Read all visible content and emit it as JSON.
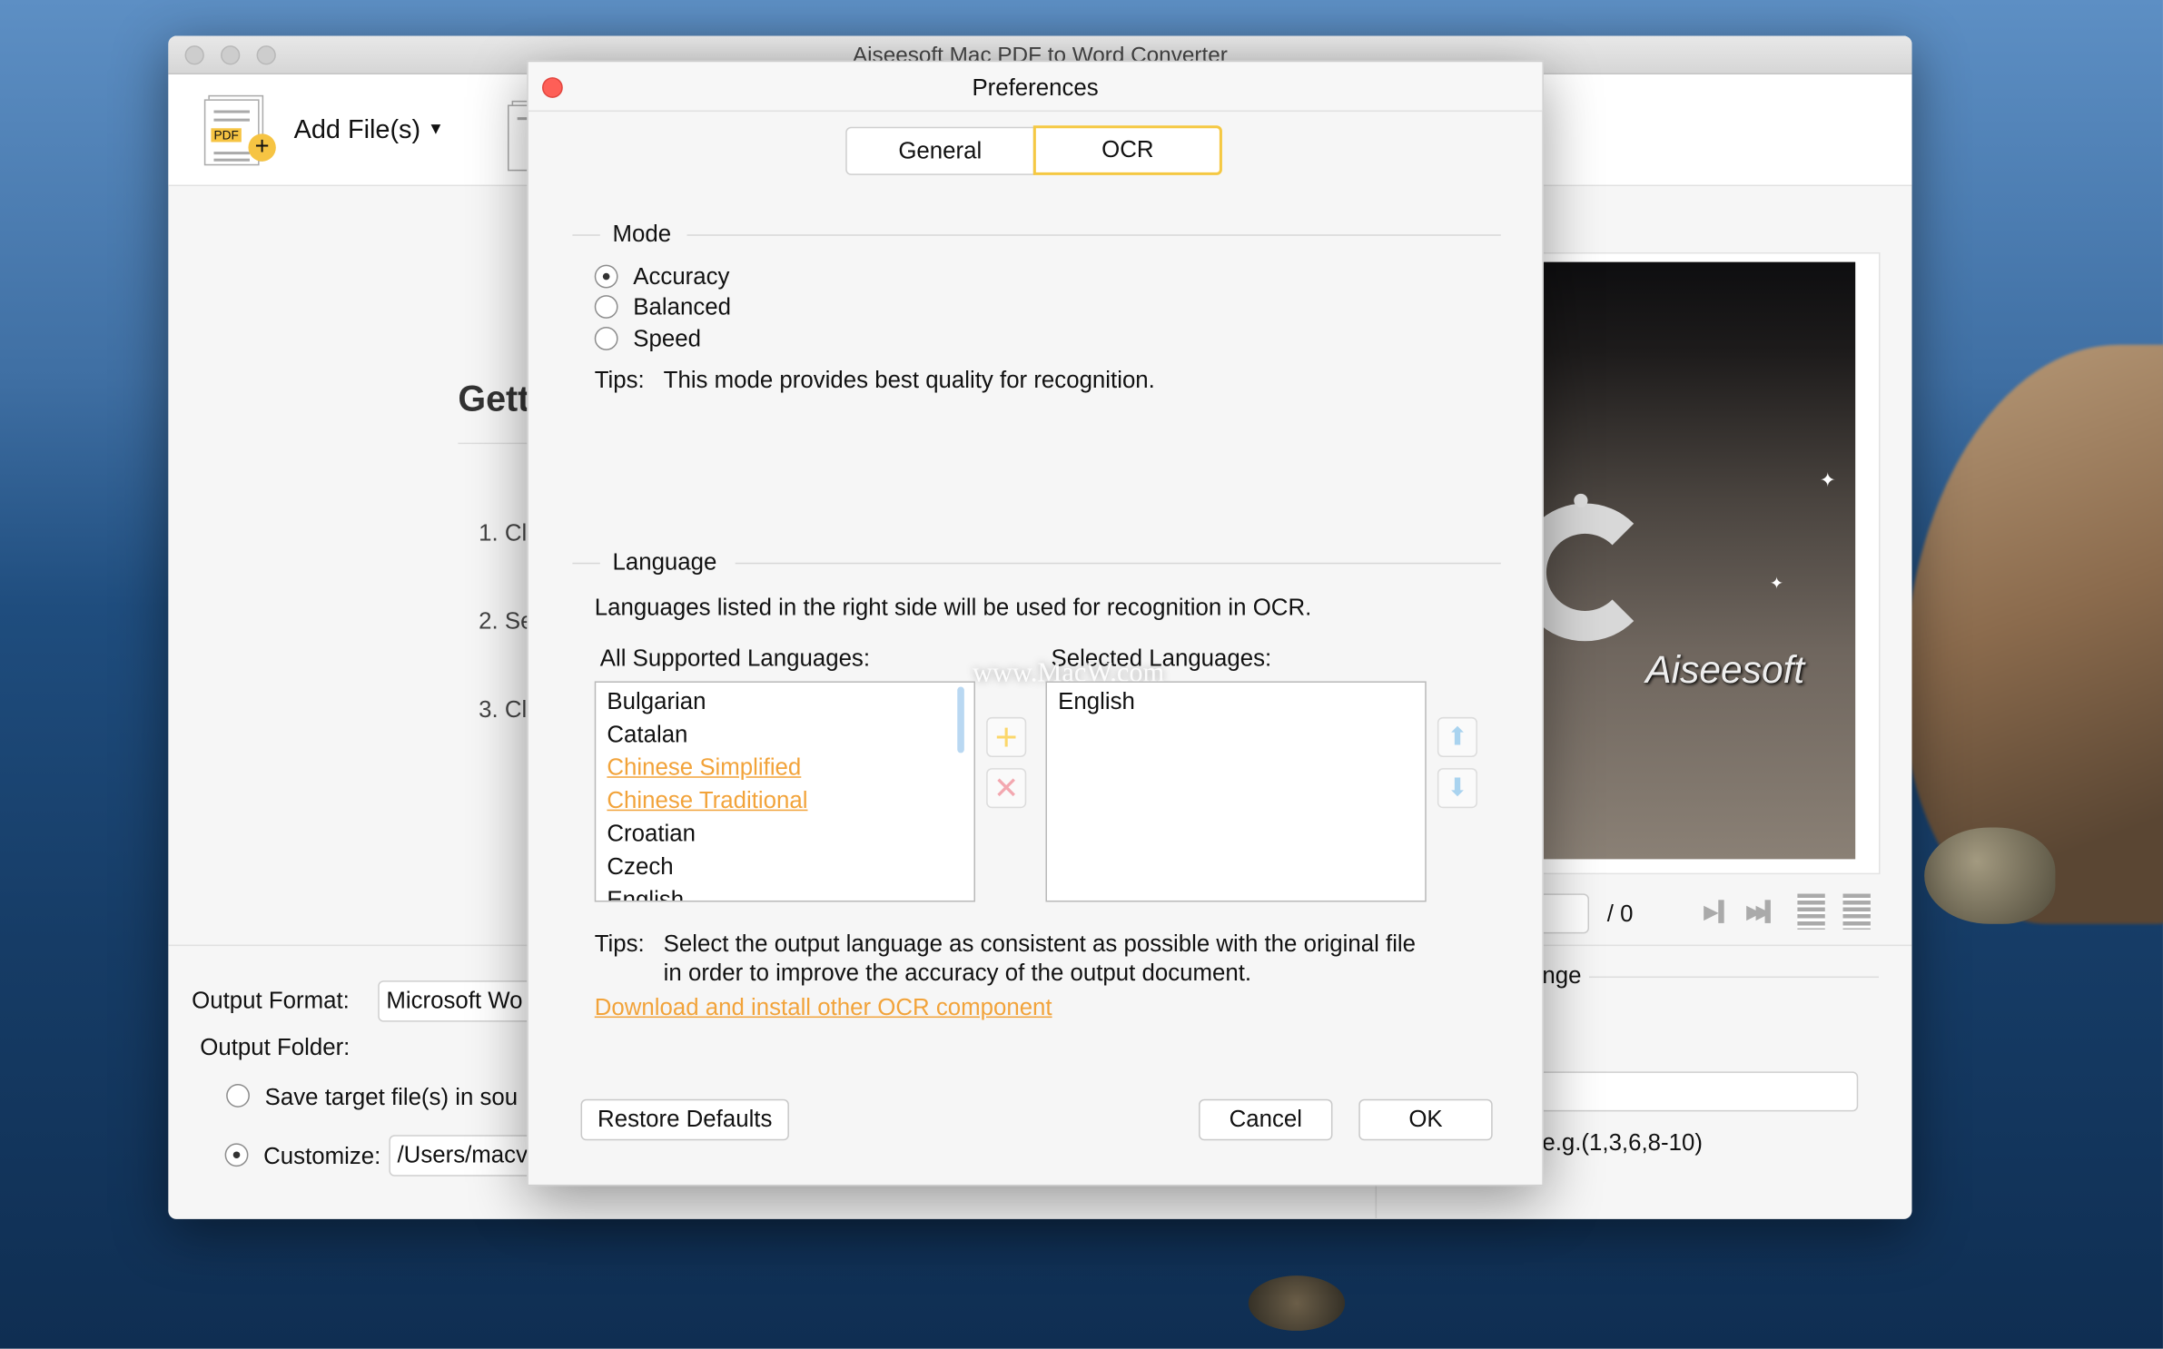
{
  "window": {
    "title": "Aiseesoft Mac PDF to Word Converter"
  },
  "toolbar": {
    "add_files_label": "Add File(s)",
    "pdf_badge": "PDF"
  },
  "main": {
    "heading": "Gett",
    "steps": [
      "1. Cl",
      "2. Se",
      "3. Cl"
    ]
  },
  "output": {
    "format_label": "Output Format:",
    "format_value": "Microsoft Wo",
    "folder_label": "Output Folder:",
    "save_source_label": "Save target file(s) in sou",
    "customize_label": "Customize:",
    "customize_value": "/Users/macv",
    "selected_folder_option": "customize"
  },
  "preview": {
    "logo_text": "Aiseesoft",
    "page_total": "/ 0",
    "range_label": "nge",
    "range_hint": "e.g.(1,3,6,8-10)"
  },
  "dialog": {
    "title": "Preferences",
    "tabs": [
      {
        "label": "General",
        "active": false
      },
      {
        "label": "OCR",
        "active": true
      }
    ],
    "mode": {
      "label": "Mode",
      "options": [
        "Accuracy",
        "Balanced",
        "Speed"
      ],
      "selected": "Accuracy",
      "tips_label": "Tips:",
      "tips_text": "This mode provides best quality for recognition."
    },
    "language": {
      "label": "Language",
      "description": "Languages listed in the right side will be used for recognition in OCR.",
      "all_label": "All Supported Languages:",
      "selected_label": "Selected Languages:",
      "all": [
        {
          "name": "Bulgarian",
          "downloadable": false
        },
        {
          "name": "Catalan",
          "downloadable": false
        },
        {
          "name": "Chinese Simplified",
          "downloadable": true
        },
        {
          "name": "Chinese Traditional",
          "downloadable": true
        },
        {
          "name": "Croatian",
          "downloadable": false
        },
        {
          "name": "Czech",
          "downloadable": false
        },
        {
          "name": "English",
          "downloadable": false
        }
      ],
      "selected": [
        "English"
      ],
      "tips_label": "Tips:",
      "tips_line1": "Select the output language as consistent as possible with the original file",
      "tips_line2": "in order to improve the accuracy of the output document.",
      "download_link": "Download and install other OCR component"
    },
    "buttons": {
      "restore": "Restore Defaults",
      "cancel": "Cancel",
      "ok": "OK"
    }
  },
  "watermark": "www.MacW.com",
  "colors": {
    "accent": "#f2a33a",
    "tab_active_border": "#f5c842",
    "close": "#fe5f57",
    "move_arrows": "#a9d3ef",
    "remove_x": "#f3a8b0",
    "add_plus": "#fbd76b"
  }
}
